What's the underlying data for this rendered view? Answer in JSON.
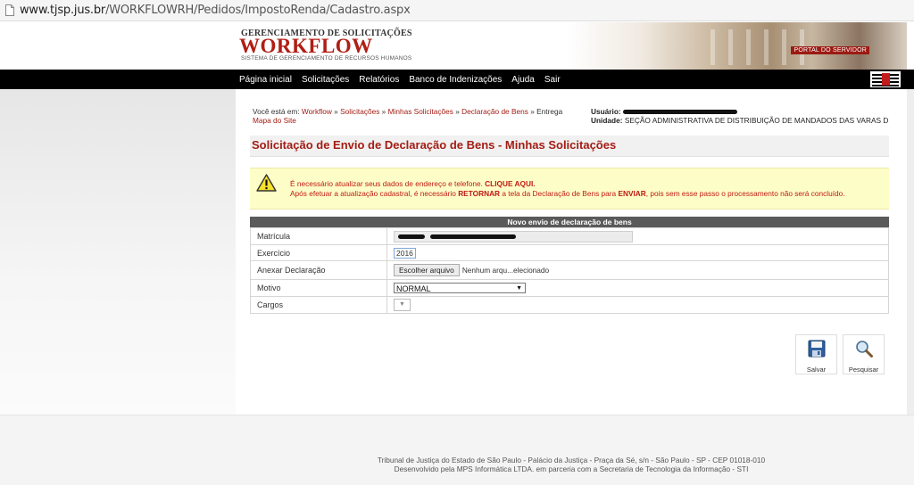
{
  "browser": {
    "url_host": "www.tjsp.jus.br",
    "url_path": "/WORKFLOWRH/Pedidos/ImpostoRenda/Cadastro.aspx"
  },
  "header": {
    "brand_top": "GERENCIAMENTO DE SOLICITAÇÕES",
    "brand_main": "WORKFLOW",
    "brand_sub": "SISTEMA DE GERENCIAMENTO DE RECURSOS HUMANOS",
    "portal_label": "PORTAL DO SERVIDOR"
  },
  "nav": {
    "items": [
      "Página inicial",
      "Solicitações",
      "Relatórios",
      "Banco de Indenizações",
      "Ajuda",
      "Sair"
    ]
  },
  "breadcrumb": {
    "prefix": "Você está em: ",
    "links": [
      "Workflow",
      "Solicitações",
      "Minhas Solicitações",
      "Declaração de Bens"
    ],
    "separator": " » ",
    "current": "Entrega",
    "sitemap": "Mapa do Site"
  },
  "user": {
    "user_label": "Usuário:",
    "unit_label": "Unidade:",
    "unit_value": "SEÇÃO ADMINISTRATIVA DE DISTRIBUIÇÃO DE MANDADOS DAS VARAS D"
  },
  "page": {
    "title": "Solicitação de Envio de Declaração de Bens - Minhas Solicitações"
  },
  "alert": {
    "line1_prefix": "É necessário atualizar seus dados de endereço e telefone. ",
    "line1_link": "CLIQUE AQUI.",
    "line2_a": "Após efetuar a atualização cadastral, é necessário ",
    "line2_b": "RETORNAR",
    "line2_c": " a tela da Declaração de Bens para ",
    "line2_d": "ENVIAR",
    "line2_e": ", pois sem esse passo o processamento não será concluído."
  },
  "form": {
    "header": "Novo envio de declaração de bens",
    "matricula_label": "Matrícula",
    "exercicio_label": "Exercício",
    "exercicio_value": "2016",
    "anexar_label": "Anexar Declaração",
    "file_button": "Escolher arquivo",
    "file_status": "Nenhum arqu...elecionado",
    "motivo_label": "Motivo",
    "motivo_value": "NORMAL",
    "cargos_label": "Cargos"
  },
  "actions": {
    "save_label": "Salvar",
    "search_label": "Pesquisar"
  },
  "footer": {
    "line1": "Tribunal de Justiça do Estado de São Paulo - Palácio da Justiça - Praça da Sé, s/n - São Paulo - SP - CEP 01018-010",
    "line2": "Desenvolvido pela MPS Informática LTDA. em parceria com a Secretaria de Tecnologia da Informação - STI"
  },
  "colors": {
    "brand_red": "#a31d14",
    "navbar": "#000000",
    "alert_bg": "#fdfdc8",
    "form_header": "#5a5a5a"
  }
}
